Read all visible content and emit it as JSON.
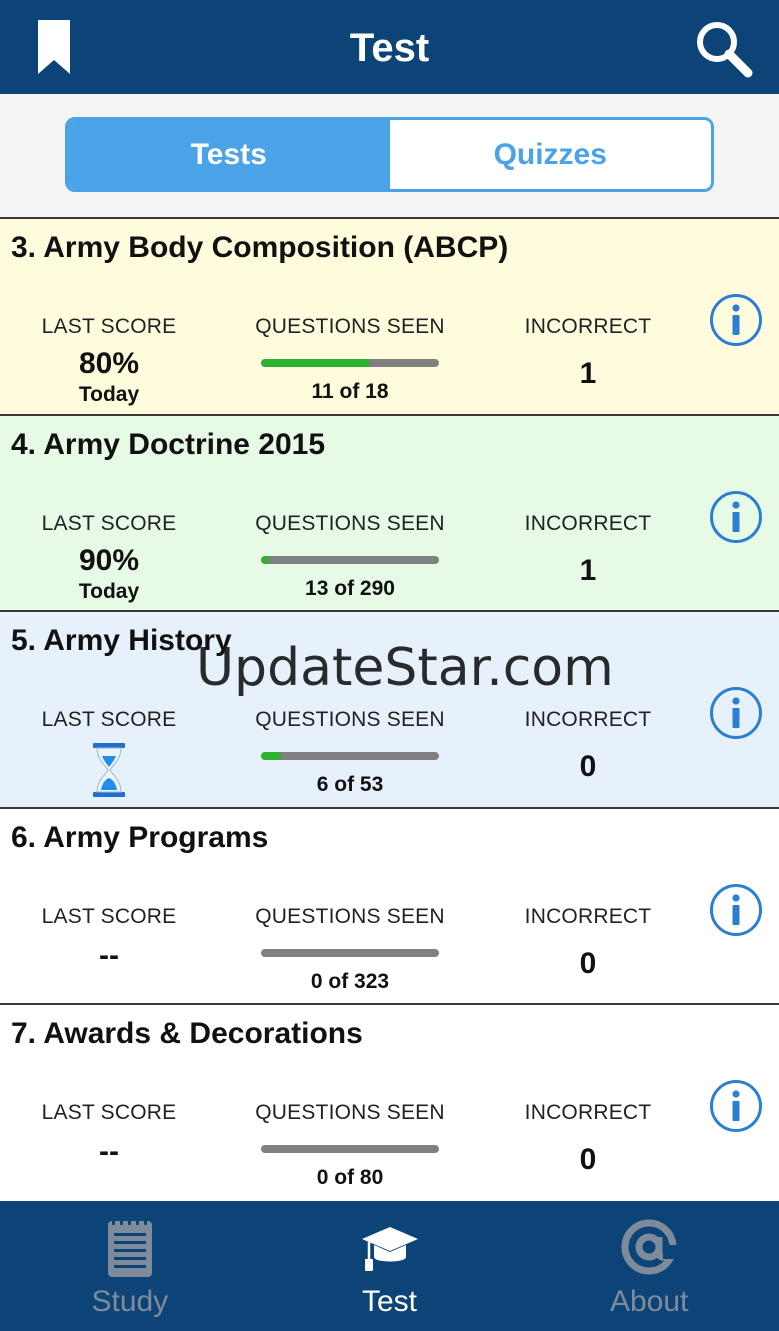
{
  "header": {
    "title": "Test",
    "bookmark_icon": "bookmark-icon",
    "search_icon": "search-icon"
  },
  "segments": {
    "tests": "Tests",
    "quizzes": "Quizzes",
    "selected": "tests"
  },
  "columns": {
    "last_score": "LAST SCORE",
    "questions_seen": "QUESTIONS SEEN",
    "incorrect": "INCORRECT"
  },
  "tests": [
    {
      "title": "3. Army Body Composition (ABCP)",
      "score": "80%",
      "score_date": "Today",
      "seen": "11 of 18",
      "seen_fraction": 0.611,
      "incorrect": "1",
      "bg": "#fefcdc"
    },
    {
      "title": "4. Army Doctrine 2015",
      "score": "90%",
      "score_date": "Today",
      "seen": "13 of 290",
      "seen_fraction": 0.045,
      "incorrect": "1",
      "bg": "#e6fae6"
    },
    {
      "title": "5. Army History",
      "score": "",
      "score_date": "",
      "score_icon": "hourglass-icon",
      "seen": "6 of 53",
      "seen_fraction": 0.113,
      "incorrect": "0",
      "bg": "#e6f1fb"
    },
    {
      "title": "6. Army Programs",
      "score": "--",
      "score_date": "",
      "seen": "0 of 323",
      "seen_fraction": 0,
      "incorrect": "0",
      "bg": "#ffffff"
    },
    {
      "title": "7. Awards & Decorations",
      "score": "--",
      "score_date": "",
      "seen": "0 of 80",
      "seen_fraction": 0,
      "incorrect": "0",
      "bg": "#ffffff"
    }
  ],
  "watermark": "UpdateStar.com",
  "tabbar": {
    "study": "Study",
    "test": "Test",
    "about": "About",
    "selected": "test"
  },
  "colors": {
    "header": "#0d4477",
    "accent": "#4aa3e6",
    "progress": "#2db22d",
    "progress_track": "#808080"
  }
}
